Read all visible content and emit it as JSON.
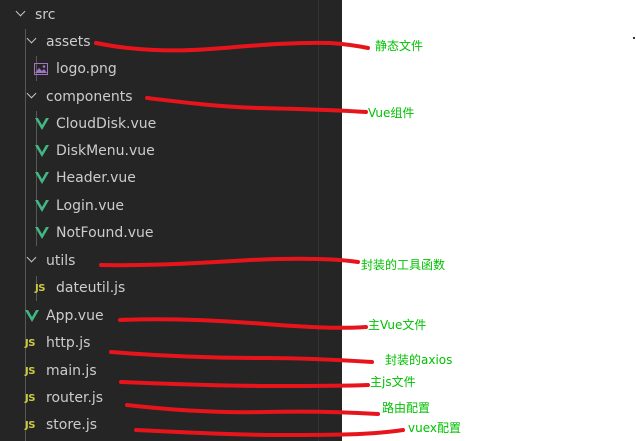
{
  "tree": {
    "src": "src",
    "assets": "assets",
    "logo": "logo.png",
    "components": "components",
    "clouddisk": "CloudDisk.vue",
    "diskmenu": "DiskMenu.vue",
    "header": "Header.vue",
    "login": "Login.vue",
    "notfound": "NotFound.vue",
    "utils": "utils",
    "dateutil": "dateutil.js",
    "app": "App.vue",
    "http": "http.js",
    "main": "main.js",
    "router": "router.js",
    "store": "store.js"
  },
  "icons": {
    "js_label": "JS",
    "vue_color": "#41b883",
    "js_color": "#cbcb41",
    "chevron": "chevron-down-icon"
  },
  "annotations": {
    "assets": "静态文件",
    "components": "Vue组件",
    "utils": "封装的工具函数",
    "app": "主Vue文件",
    "http": "封装的axios",
    "main": "主js文件",
    "router": "路由配置",
    "store": "vuex配置"
  },
  "colors": {
    "sidebar_bg": "#252526",
    "text": "#cccccc",
    "annotation": "#00c000",
    "marker": "#e8141c"
  }
}
